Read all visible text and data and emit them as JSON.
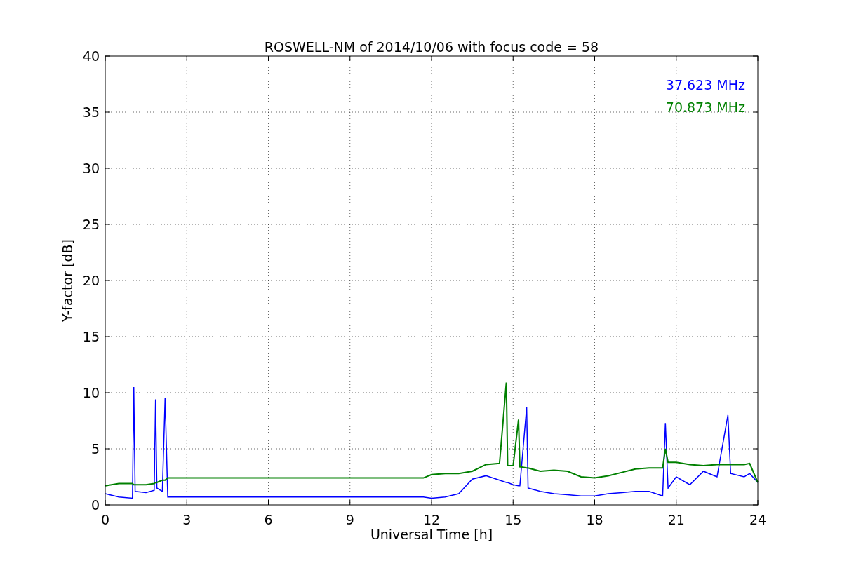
{
  "figure": {
    "chart_data": {
      "type": "line",
      "title": "ROSWELL-NM of 2014/10/06 with focus code = 58",
      "xlabel": "Universal Time [h]",
      "ylabel": "Y-factor [dB]",
      "x": [
        0,
        0.5,
        1,
        1.05,
        1.1,
        1.5,
        1.8,
        1.85,
        1.9,
        2.1,
        2.2,
        2.3,
        6,
        11.7,
        12,
        12.5,
        13,
        13.5,
        14,
        14.5,
        14.75,
        14.8,
        15,
        15.2,
        15.25,
        15.5,
        15.55,
        16,
        16.5,
        17,
        17.5,
        18,
        18.5,
        19,
        19.5,
        20,
        20.5,
        20.6,
        20.7,
        21,
        21.5,
        22,
        22.5,
        22.9,
        23,
        23.5,
        23.7,
        24
      ],
      "series": [
        {
          "name": "37.623 MHz",
          "color": "#0000ff",
          "values": [
            1.0,
            0.7,
            0.6,
            10.5,
            1.2,
            1.1,
            1.3,
            9.4,
            1.5,
            1.2,
            9.5,
            0.7,
            0.7,
            0.7,
            0.6,
            0.7,
            1.0,
            2.3,
            2.6,
            2.2,
            2.0,
            2.0,
            1.8,
            1.7,
            1.7,
            8.7,
            1.5,
            1.2,
            1.0,
            0.9,
            0.8,
            0.8,
            1.0,
            1.1,
            1.2,
            1.2,
            0.8,
            7.3,
            1.5,
            2.5,
            1.8,
            3.0,
            2.5,
            8.0,
            2.8,
            2.5,
            2.8,
            2.0
          ]
        },
        {
          "name": "70.873 MHz",
          "color": "#008000",
          "values": [
            1.7,
            1.9,
            1.9,
            1.8,
            1.8,
            1.8,
            1.9,
            2.0,
            2.0,
            2.2,
            2.2,
            2.4,
            2.4,
            2.4,
            2.7,
            2.8,
            2.8,
            3.0,
            3.6,
            3.7,
            10.9,
            3.5,
            3.5,
            7.6,
            3.4,
            3.3,
            3.3,
            3.0,
            3.1,
            3.0,
            2.5,
            2.4,
            2.6,
            2.9,
            3.2,
            3.3,
            3.3,
            5.0,
            3.8,
            3.8,
            3.6,
            3.5,
            3.6,
            3.6,
            3.6,
            3.6,
            3.7,
            2.0
          ]
        }
      ],
      "grid": true,
      "xlim": [
        0,
        24
      ],
      "ylim": [
        0,
        40
      ],
      "xticks": [
        0,
        3,
        6,
        9,
        12,
        15,
        18,
        21,
        24
      ],
      "yticks": [
        0,
        5,
        10,
        15,
        20,
        25,
        30,
        35,
        40
      ]
    }
  }
}
